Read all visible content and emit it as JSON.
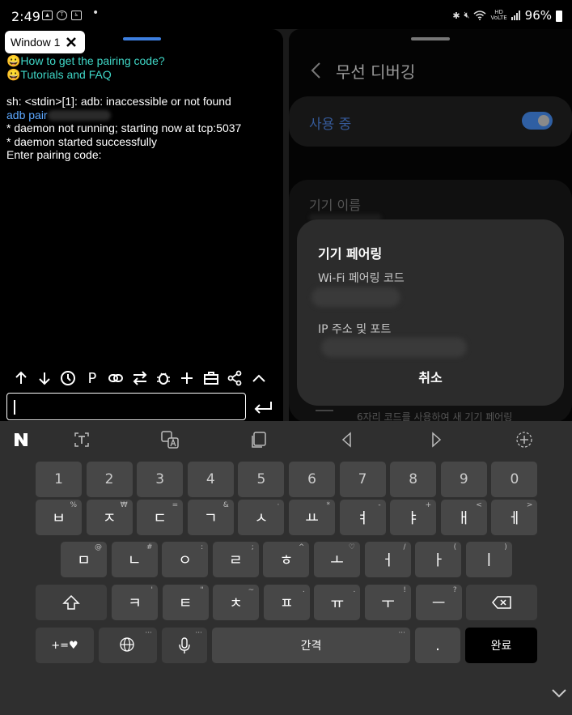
{
  "status_bar": {
    "time": "2:49",
    "left_icons": [
      "gallery-icon",
      "talk-icon",
      "accessibility-icon"
    ],
    "right_icons": [
      "bluetooth-icon",
      "mute-icon",
      "wifi-icon",
      "hd-voice-icon",
      "signal-icon"
    ],
    "hd_label_top": "HD",
    "hd_label_bottom": "VoLTE",
    "battery": "96%"
  },
  "left_window": {
    "tab_label": "Window 1",
    "terminal_lines": {
      "link1": "😀How to get the pairing code?",
      "link2": "😀Tutorials and FAQ",
      "line1": "sh: <stdin>[1]: adb: inaccessible or not found",
      "line2_cmd": "adb  pair",
      "line3": "* daemon not running; starting now at tcp:5037",
      "line4": "* daemon started successfully",
      "line5": "Enter pairing code:"
    },
    "toolbar_icons": [
      "arrow-up-icon",
      "arrow-down-icon",
      "clock-icon",
      "p-icon",
      "link-icon",
      "swap-icon",
      "bug-icon",
      "plus-icon",
      "toolbox-icon",
      "share-icon",
      "chevron-up-icon"
    ],
    "p_label": "P",
    "input_value": ""
  },
  "right_window": {
    "title": "무선 디버깅",
    "toggle_label": "사용 중",
    "toggle_on": true,
    "device_name_label": "기기 이름",
    "footer_text": "6자리 코드를 사용하여 새 기기 페어링",
    "dialog": {
      "title": "기기 페어링",
      "code_label": "Wi-Fi 페어링 코드",
      "ip_label": "IP 주소 및 포트",
      "cancel_label": "취소"
    }
  },
  "keyboard": {
    "number_row": [
      "1",
      "2",
      "3",
      "4",
      "5",
      "6",
      "7",
      "8",
      "9",
      "0"
    ],
    "row1": [
      {
        "k": "ㅂ",
        "s": "%"
      },
      {
        "k": "ㅈ",
        "s": "₩"
      },
      {
        "k": "ㄷ",
        "s": "="
      },
      {
        "k": "ㄱ",
        "s": "&"
      },
      {
        "k": "ㅅ",
        "s": "·"
      },
      {
        "k": "ㅛ",
        "s": "*"
      },
      {
        "k": "ㅕ",
        "s": "-"
      },
      {
        "k": "ㅑ",
        "s": "+"
      },
      {
        "k": "ㅐ",
        "s": "<"
      },
      {
        "k": "ㅔ",
        "s": ">"
      }
    ],
    "row2": [
      {
        "k": "ㅁ",
        "s": "@"
      },
      {
        "k": "ㄴ",
        "s": "#"
      },
      {
        "k": "ㅇ",
        "s": ":"
      },
      {
        "k": "ㄹ",
        "s": ";"
      },
      {
        "k": "ㅎ",
        "s": "^"
      },
      {
        "k": "ㅗ",
        "s": "♡"
      },
      {
        "k": "ㅓ",
        "s": "/"
      },
      {
        "k": "ㅏ",
        "s": "("
      },
      {
        "k": "ㅣ",
        "s": ")"
      }
    ],
    "row3": [
      {
        "k": "ㅋ",
        "s": "'"
      },
      {
        "k": "ㅌ",
        "s": "\""
      },
      {
        "k": "ㅊ",
        "s": "~"
      },
      {
        "k": "ㅍ",
        "s": "."
      },
      {
        "k": "ㅠ",
        "s": "."
      },
      {
        "k": "ㅜ",
        "s": "!"
      },
      {
        "k": "ㅡ",
        "s": "?"
      }
    ],
    "symbols_label": "+=♥",
    "space_label": "간격",
    "period_label": ".",
    "done_label": "완료",
    "more_hint": "···"
  }
}
